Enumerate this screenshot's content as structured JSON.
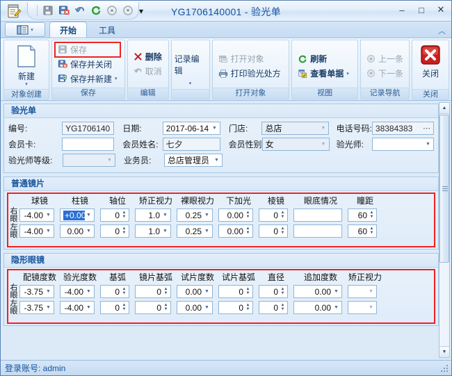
{
  "window": {
    "title": "YG1706140001 - 验光单",
    "minimize": "–",
    "maximize": "□",
    "close": "✕"
  },
  "quick_access": {
    "buttons": [
      {
        "name": "save-icon",
        "tooltip": "保存"
      },
      {
        "name": "save-close-icon",
        "tooltip": "保存并关闭"
      },
      {
        "name": "undo-icon",
        "tooltip": "撤销"
      },
      {
        "name": "refresh-icon",
        "tooltip": "刷新"
      },
      {
        "name": "prev-record-icon",
        "tooltip": "上一条"
      },
      {
        "name": "next-record-icon",
        "tooltip": "下一条"
      }
    ],
    "dropdown": "▾"
  },
  "tabs": {
    "app_menu": "▾",
    "items": [
      {
        "label": "开始",
        "active": true
      },
      {
        "label": "工具",
        "active": false
      }
    ],
    "collapse": "︿"
  },
  "ribbon": {
    "groups": [
      {
        "label": "对象创建",
        "big_button": {
          "label": "新建",
          "arrow": "▾"
        }
      },
      {
        "label": "保存",
        "buttons": [
          {
            "label": "保存",
            "disabled": true,
            "highlighted": true
          },
          {
            "label": "保存并关闭",
            "disabled": false,
            "highlighted": false
          },
          {
            "label": "保存并新建",
            "disabled": false,
            "highlighted": false,
            "split": "▾"
          }
        ]
      },
      {
        "label": "编辑",
        "buttons": [
          {
            "label": "删除",
            "disabled": false
          },
          {
            "label": "取消",
            "disabled": true
          }
        ]
      },
      {
        "label": "",
        "big_button": {
          "label": "记录编辑",
          "arrow": "▾"
        }
      },
      {
        "label": "打开对象",
        "buttons": [
          {
            "label": "打开对象",
            "disabled": true
          },
          {
            "label": "打印验光处方",
            "disabled": false
          }
        ]
      },
      {
        "label": "视图",
        "buttons": [
          {
            "label": "刷新",
            "disabled": false
          },
          {
            "label": "查看单据",
            "disabled": false,
            "split": "▾"
          }
        ]
      },
      {
        "label": "记录导航",
        "buttons": [
          {
            "label": "上一条",
            "disabled": true
          },
          {
            "label": "下一条",
            "disabled": true
          }
        ]
      },
      {
        "label": "关闭",
        "big_button": {
          "label": "关闭"
        }
      }
    ]
  },
  "form": {
    "title": "验光单",
    "rows": [
      [
        {
          "label": "编号:",
          "value": "YG1706140",
          "type": "text",
          "readonly": true
        },
        {
          "label": "日期:",
          "value": "2017-06-14",
          "type": "combo"
        },
        {
          "label": "门店:",
          "value": "总店",
          "type": "combo"
        },
        {
          "label": "电话号码:",
          "value": "38384383",
          "type": "text",
          "ellipsis": "⋯"
        }
      ],
      [
        {
          "label": "会员卡:",
          "value": "",
          "type": "text"
        },
        {
          "label": "会员姓名:",
          "value": "七夕",
          "type": "text",
          "readonly": true
        },
        {
          "label": "会员性别:",
          "value": "女",
          "type": "combo",
          "readonly": true
        },
        {
          "label": "验光师:",
          "value": "",
          "type": "combo"
        }
      ],
      [
        {
          "label": "验光师等级:",
          "value": "",
          "type": "combo",
          "readonly": true
        },
        {
          "label": "业务员:",
          "value": "总店管理员",
          "type": "combo"
        }
      ]
    ]
  },
  "normal_lens": {
    "title": "普通镜片",
    "columns": [
      "球镜",
      "柱镜",
      "轴位",
      "矫正视力",
      "裸眼视力",
      "下加光",
      "棱镜",
      "眼底情况",
      "瞳距"
    ],
    "rows": [
      {
        "eye": "右眼",
        "cells": [
          {
            "value": "-4.00",
            "type": "combo"
          },
          {
            "value": "+0.00",
            "type": "combo",
            "selected": true
          },
          {
            "value": "0",
            "type": "spin"
          },
          {
            "value": "1.0",
            "type": "combo"
          },
          {
            "value": "0.25",
            "type": "combo"
          },
          {
            "value": "0.00",
            "type": "spin"
          },
          {
            "value": "0",
            "type": "spin"
          },
          {
            "value": "",
            "type": "text"
          },
          {
            "value": "60",
            "type": "spin"
          }
        ]
      },
      {
        "eye": "左眼",
        "cells": [
          {
            "value": "-4.00",
            "type": "combo"
          },
          {
            "value": "0.00",
            "type": "combo"
          },
          {
            "value": "0",
            "type": "spin"
          },
          {
            "value": "1.0",
            "type": "combo"
          },
          {
            "value": "0.25",
            "type": "combo"
          },
          {
            "value": "0.00",
            "type": "spin"
          },
          {
            "value": "0",
            "type": "spin"
          },
          {
            "value": "",
            "type": "text"
          },
          {
            "value": "60",
            "type": "spin"
          }
        ]
      }
    ]
  },
  "contact_lens": {
    "title": "隐形眼镜",
    "columns": [
      "配镜度数",
      "验光度数",
      "基弧",
      "镜片基弧",
      "试片度数",
      "试片基弧",
      "直径",
      "追加度数",
      "矫正视力"
    ],
    "rows": [
      {
        "eye": "右眼",
        "cells": [
          {
            "value": "-3.75",
            "type": "combo"
          },
          {
            "value": "-4.00",
            "type": "combo"
          },
          {
            "value": "0",
            "type": "spin"
          },
          {
            "value": "0",
            "type": "spin"
          },
          {
            "value": "0.00",
            "type": "combo"
          },
          {
            "value": "0",
            "type": "spin"
          },
          {
            "value": "0",
            "type": "spin"
          },
          {
            "value": "0.00",
            "type": "combo"
          },
          {
            "value": "",
            "type": "combo"
          }
        ]
      },
      {
        "eye": "左眼",
        "cells": [
          {
            "value": "-3.75",
            "type": "combo"
          },
          {
            "value": "-4.00",
            "type": "combo"
          },
          {
            "value": "0",
            "type": "spin"
          },
          {
            "value": "0",
            "type": "spin"
          },
          {
            "value": "0.00",
            "type": "combo"
          },
          {
            "value": "0",
            "type": "spin"
          },
          {
            "value": "0",
            "type": "spin"
          },
          {
            "value": "0.00",
            "type": "combo"
          },
          {
            "value": "",
            "type": "combo"
          }
        ]
      }
    ]
  },
  "statusbar": {
    "text": "登录账号: admin"
  },
  "colors": {
    "title_text": "#17519e",
    "panel_header_text": "#14539e",
    "highlight_border": "#ee2222",
    "selection": "#2a6fd4"
  }
}
